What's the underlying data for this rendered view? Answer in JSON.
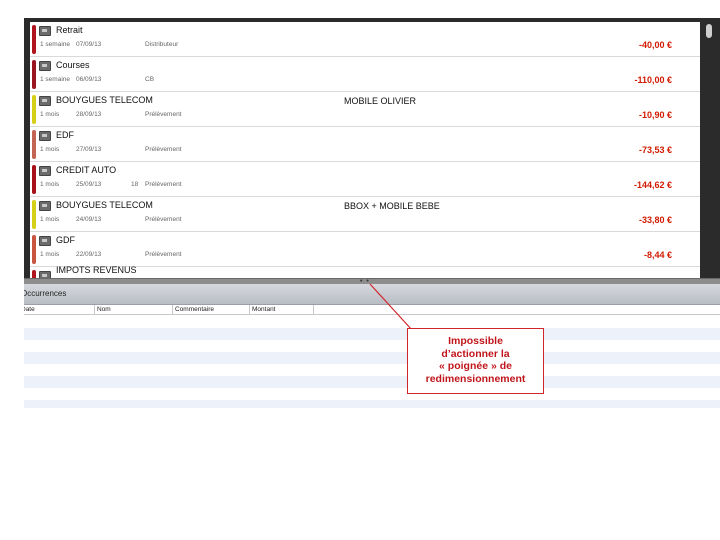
{
  "transactions": [
    {
      "title": "Retrait",
      "comment": "",
      "freq": "1 semaine",
      "date": "07/09/13",
      "num": "",
      "mode": "Distributeur",
      "amount": "-40,00 €",
      "color": "#b0141c"
    },
    {
      "title": "Courses",
      "comment": "",
      "freq": "1 semaine",
      "date": "06/09/13",
      "num": "",
      "mode": "CB",
      "amount": "-110,00 €",
      "color": "#9b1620"
    },
    {
      "title": "BOUYGUES TELECOM",
      "comment": "MOBILE OLIVIER",
      "freq": "1 mois",
      "date": "28/09/13",
      "num": "",
      "mode": "Prélèvement",
      "amount": "-10,90 €",
      "color": "#d6cf18"
    },
    {
      "title": "EDF",
      "comment": "",
      "freq": "1 mois",
      "date": "27/09/13",
      "num": "",
      "mode": "Prélèvement",
      "amount": "-73,53 €",
      "color": "#c46452"
    },
    {
      "title": "CREDIT AUTO",
      "comment": "",
      "freq": "1 mois",
      "date": "25/09/13",
      "num": "18",
      "mode": "Prélèvement",
      "amount": "-144,62 €",
      "color": "#a8101a"
    },
    {
      "title": "BOUYGUES TELECOM",
      "comment": "BBOX + MOBILE BEBE",
      "freq": "1 mois",
      "date": "24/09/13",
      "num": "",
      "mode": "Prélèvement",
      "amount": "-33,80 €",
      "color": "#d6cf18"
    },
    {
      "title": "GDF",
      "comment": "",
      "freq": "1 mois",
      "date": "22/09/13",
      "num": "",
      "mode": "Prélèvement",
      "amount": "-8,44 €",
      "color": "#c7553f"
    }
  ],
  "partial_row": {
    "title": "IMPOTS REVENUS",
    "color": "#b0141c"
  },
  "occurrences": {
    "title": "Occurrences",
    "columns": [
      "Date",
      "Nom",
      "Commentaire",
      "Montant"
    ]
  },
  "callout": {
    "lines": [
      "Impossible",
      "d’actionner la",
      "« poignée » de",
      "redimensionnement"
    ]
  },
  "colors": {
    "accent": "#d11a00",
    "callout_border": "#d0262b"
  }
}
